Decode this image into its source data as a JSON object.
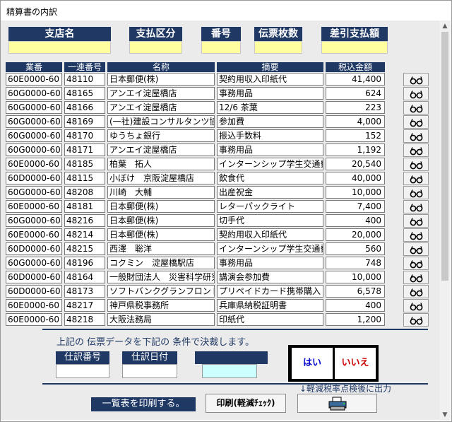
{
  "window": {
    "title": "精算書の内訳"
  },
  "header": {
    "branch_label": "支店名",
    "payment_type_label": "支払区分",
    "number_label": "番号",
    "slip_count_label": "伝票枚数",
    "net_payment_label": "差引支払額"
  },
  "table": {
    "columns": [
      "業番",
      "一連番号",
      "名称",
      "摘要",
      "税込金額"
    ],
    "rows": [
      {
        "gyoban": "60E0000-60",
        "seq": "48110",
        "name": "日本郵便(株)",
        "desc": "契約用収入印紙代",
        "amount": "41,400"
      },
      {
        "gyoban": "60G0000-60",
        "seq": "48165",
        "name": "アンエイ淀屋橋店",
        "desc": "事務用品",
        "amount": "624"
      },
      {
        "gyoban": "60G0000-60",
        "seq": "48166",
        "name": "アンエイ淀屋橋店",
        "desc": "12/6 茶葉",
        "amount": "223"
      },
      {
        "gyoban": "60G0000-60",
        "seq": "48169",
        "name": "(一社)建設コンサルタンツ協",
        "desc": "参加費",
        "amount": "4,000"
      },
      {
        "gyoban": "60G0000-60",
        "seq": "48170",
        "name": "ゆうちょ銀行",
        "desc": "振込手数料",
        "amount": "152"
      },
      {
        "gyoban": "60G0000-60",
        "seq": "48171",
        "name": "アンエイ淀屋橋店",
        "desc": "事務用品",
        "amount": "1,192"
      },
      {
        "gyoban": "60E0000-60",
        "seq": "48185",
        "name": "柏葉　拓人",
        "desc": "インターンシップ学生交通費",
        "amount": "20,540"
      },
      {
        "gyoban": "60D0000-60",
        "seq": "48115",
        "name": "小ぼけ　京阪淀屋橋店",
        "desc": "飲食代",
        "amount": "40,000"
      },
      {
        "gyoban": "60G0000-60",
        "seq": "48208",
        "name": "川崎　大輔",
        "desc": "出産祝金",
        "amount": "10,000"
      },
      {
        "gyoban": "60E0000-60",
        "seq": "48181",
        "name": "日本郵便(株)",
        "desc": "レターパックライト",
        "amount": "7,400"
      },
      {
        "gyoban": "60G0000-60",
        "seq": "48216",
        "name": "日本郵便(株)",
        "desc": "切手代",
        "amount": "400"
      },
      {
        "gyoban": "60E0000-60",
        "seq": "48214",
        "name": "日本郵便(株)",
        "desc": "契約用収入印紙代",
        "amount": "20,000"
      },
      {
        "gyoban": "60D0000-60",
        "seq": "48215",
        "name": "西澤　聡洋",
        "desc": "インターンシップ学生交通費",
        "amount": "560"
      },
      {
        "gyoban": "60G0000-60",
        "seq": "48196",
        "name": "コクミン　淀屋橋駅店",
        "desc": "事務用品",
        "amount": "748"
      },
      {
        "gyoban": "60D0000-60",
        "seq": "48164",
        "name": "一般財団法人　災害科学研究",
        "desc": "講演会参加費",
        "amount": "10,000"
      },
      {
        "gyoban": "60D0000-60",
        "seq": "48173",
        "name": "ソフトバンクグランフロント大阪",
        "desc": "プリペイドカード携帯購入",
        "amount": "6,578"
      },
      {
        "gyoban": "60E0000-60",
        "seq": "48217",
        "name": "神戸県税事務所",
        "desc": "兵庫県納税証明書",
        "amount": "400"
      },
      {
        "gyoban": "60E0000-60",
        "seq": "48218",
        "name": "大阪法務局",
        "desc": "印紙代",
        "amount": "1,200"
      }
    ],
    "row_button_icon": "glasses-icon"
  },
  "settle": {
    "message": "上記の 伝票データを下記の 条件で決裁します。",
    "journal_no_label": "仕訳番号",
    "journal_date_label": "仕訳日付",
    "yes_label": "はい",
    "no_label": "いいえ"
  },
  "print": {
    "note": "↓軽減税率点検後に出力",
    "message": "一覧表を印刷する。",
    "print_check_label": "印刷(軽減ﾁｪｯｸ)",
    "printer_icon": "printer-icon"
  },
  "colors": {
    "navy": "#1f3864",
    "field_yellow": "#ffffa0",
    "field_cyan": "#ccffff",
    "yes_color": "#0000cc",
    "no_color": "#cc0000"
  }
}
